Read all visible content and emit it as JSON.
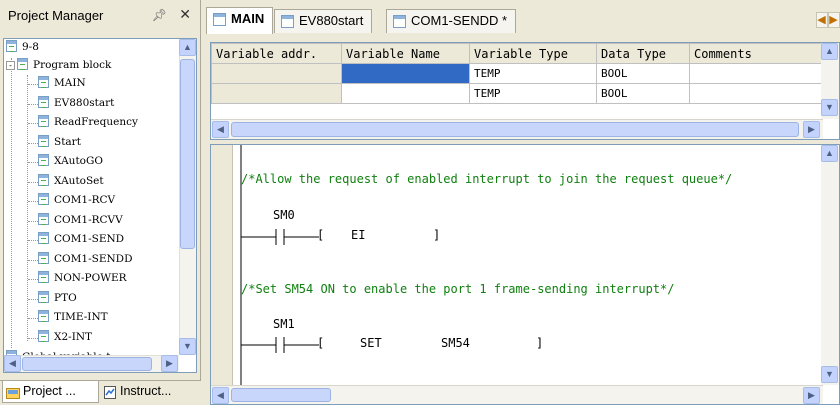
{
  "project_manager": {
    "title": "Project Manager",
    "pin_icon": "pin-icon",
    "close_icon": "close-icon",
    "tree": {
      "root": "9-8",
      "program_block": "Program block",
      "programs": [
        "MAIN",
        "EV880start",
        "ReadFrequency",
        "Start",
        "XAutoGO",
        "XAutoSet",
        "COM1-RCV",
        "COM1-RCVV",
        "COM1-SEND",
        "COM1-SENDD",
        "NON-POWER",
        "PTO",
        "TIME-INT",
        "X2-INT"
      ],
      "global_variable": "Global variable t"
    },
    "bottom_tabs": [
      {
        "label": "Project ...",
        "icon": "project-icon"
      },
      {
        "label": "Instruct...",
        "icon": "instruction-icon"
      }
    ]
  },
  "editor_tabs": [
    {
      "label": "MAIN",
      "active": true
    },
    {
      "label": "EV880start",
      "active": false
    },
    {
      "label": "COM1-SENDD *",
      "active": false
    }
  ],
  "tab_nav": {
    "prev": "◀",
    "next": "▶"
  },
  "variable_table": {
    "headers": [
      "Variable addr.",
      "Variable Name",
      "Variable Type",
      "Data Type",
      "Comments"
    ],
    "rows": [
      [
        "",
        "",
        "TEMP",
        "BOOL",
        ""
      ],
      [
        "",
        "",
        "TEMP",
        "BOOL",
        ""
      ]
    ]
  },
  "ladder": {
    "networks": [
      {
        "comment": "/*Allow the request of enabled interrupt to join the request queue*/",
        "contact": "SM0",
        "instruction": "EI",
        "operand": ""
      },
      {
        "comment": "/*Set SM54 ON to enable the port 1 frame-sending interrupt*/",
        "contact": "SM1",
        "instruction": "SET",
        "operand": "SM54"
      }
    ]
  },
  "colors": {
    "selection": "#316ac5",
    "comment_green": "#108010",
    "window_bg": "#ece9d8",
    "scroll_button": "#c3d3fd"
  }
}
